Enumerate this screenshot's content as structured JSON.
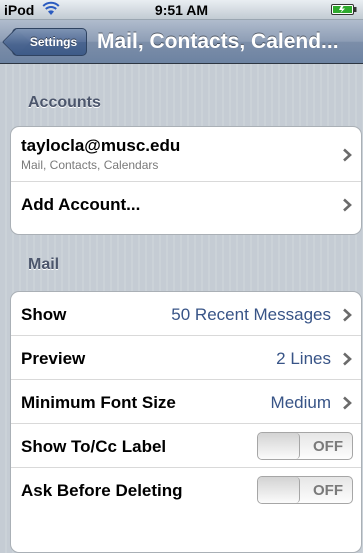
{
  "status_bar": {
    "carrier": "iPod",
    "time": "9:51 AM",
    "wifi_icon": "wifi-icon",
    "battery_icon": "battery-icon"
  },
  "nav": {
    "back_label": "Settings",
    "title": "Mail, Contacts, Calend..."
  },
  "accounts_section": {
    "header": "Accounts",
    "account": {
      "email": "taylocla@musc.edu",
      "services": "Mail, Contacts, Calendars"
    },
    "add_account_label": "Add Account..."
  },
  "mail_section": {
    "header": "Mail",
    "show": {
      "label": "Show",
      "value": "50 Recent Messages"
    },
    "preview": {
      "label": "Preview",
      "value": "2 Lines"
    },
    "min_font": {
      "label": "Minimum Font Size",
      "value": "Medium"
    },
    "show_tocc": {
      "label": "Show To/Cc Label",
      "state": "OFF"
    },
    "ask_delete": {
      "label": "Ask Before Deleting",
      "state": "OFF"
    }
  },
  "colors": {
    "value_blue": "#385487",
    "section_header": "#4c566c"
  }
}
